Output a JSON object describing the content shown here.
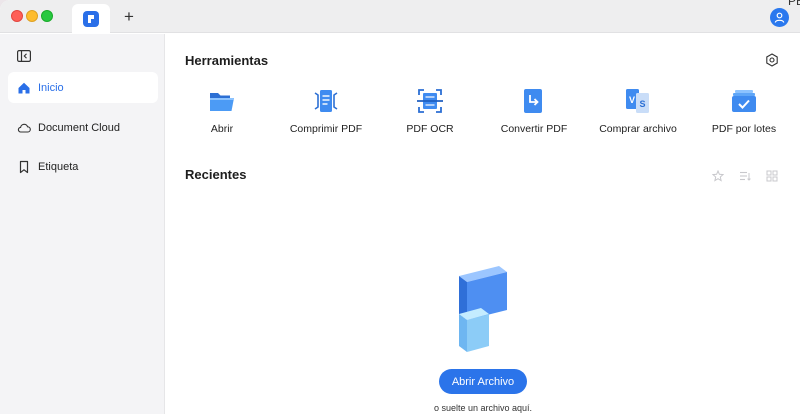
{
  "titlebar": {
    "new_tab_label": "+",
    "corner_text": "PE"
  },
  "sidebar": {
    "items": [
      {
        "label": "Inicio",
        "icon": "home-icon",
        "active": true
      },
      {
        "label": "Document Cloud",
        "icon": "cloud-icon",
        "active": false
      },
      {
        "label": "Etiqueta",
        "icon": "bookmark-icon",
        "active": false
      }
    ]
  },
  "tools": {
    "title": "Herramientas",
    "items": [
      {
        "label": "Abrir",
        "icon": "folder-open-icon"
      },
      {
        "label": "Comprimir PDF",
        "icon": "compress-pdf-icon"
      },
      {
        "label": "PDF OCR",
        "icon": "ocr-scan-icon"
      },
      {
        "label": "Convertir PDF",
        "icon": "convert-pdf-icon"
      },
      {
        "label": "Comprar archivo",
        "icon": "compare-files-icon"
      },
      {
        "label": "PDF por lotes",
        "icon": "batch-pdf-icon"
      }
    ]
  },
  "recents": {
    "title": "Recientes",
    "open_button_label": "Abrir Archivo",
    "drop_hint": "o suelte un archivo aquí."
  },
  "colors": {
    "accent": "#2b74ea",
    "sidebar_bg": "#f4f4f6"
  }
}
